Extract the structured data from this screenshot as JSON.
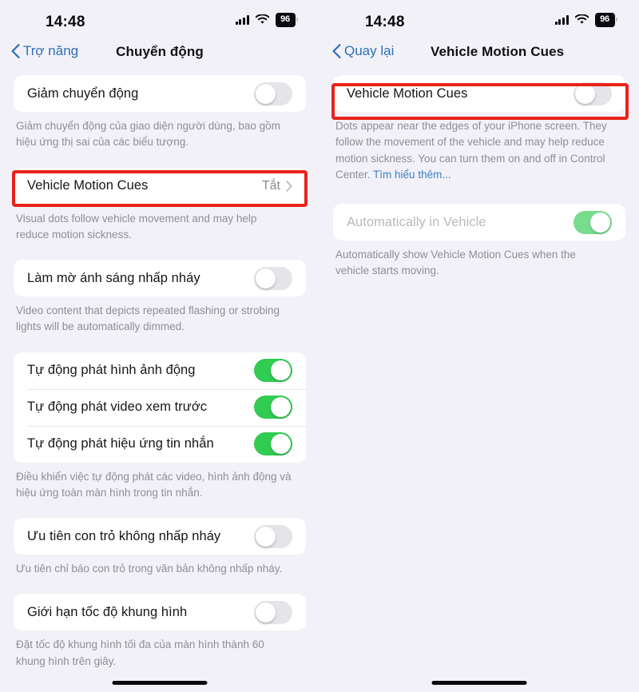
{
  "status_bar": {
    "time": "14:48",
    "battery_level": "96",
    "cellular_icon": "cellular-bars-icon",
    "wifi_icon": "wifi-icon",
    "battery_icon": "battery-icon"
  },
  "left_screen": {
    "nav": {
      "back_label": "Trợ năng",
      "back_icon": "chevron-left-icon",
      "title": "Chuyển động"
    },
    "groups": [
      {
        "rows": [
          {
            "label": "Giảm chuyển động",
            "control": "toggle",
            "state": "off"
          }
        ],
        "footnote": "Giảm chuyển động của giao diện người dùng, bao gồm hiệu ứng thị sai của các biểu tượng."
      },
      {
        "highlighted": true,
        "rows": [
          {
            "label": "Vehicle Motion Cues",
            "control": "disclosure",
            "value": "Tắt",
            "chevron_icon": "chevron-right-icon"
          }
        ],
        "footnote": "Visual dots follow vehicle movement and may help reduce motion sickness."
      },
      {
        "rows": [
          {
            "label": "Làm mờ ánh sáng nhấp nháy",
            "control": "toggle",
            "state": "off"
          }
        ],
        "footnote": "Video content that depicts repeated flashing or strobing lights will be automatically dimmed."
      },
      {
        "rows": [
          {
            "label": "Tự động phát hình ảnh động",
            "control": "toggle",
            "state": "on"
          },
          {
            "label": "Tự động phát video xem trước",
            "control": "toggle",
            "state": "on"
          },
          {
            "label": "Tự động phát hiệu ứng tin nhắn",
            "control": "toggle",
            "state": "on"
          }
        ],
        "footnote": "Điều khiển việc tự động phát các video, hình ảnh động và hiệu ứng toàn màn hình trong tin nhắn."
      },
      {
        "rows": [
          {
            "label": "Ưu tiên con trỏ không nhấp nháy",
            "control": "toggle",
            "state": "off"
          }
        ],
        "footnote": "Ưu tiên chỉ báo con trỏ trong văn bản không nhấp nháy."
      },
      {
        "rows": [
          {
            "label": "Giới hạn tốc độ khung hình",
            "control": "toggle",
            "state": "off"
          }
        ],
        "footnote": "Đặt tốc độ khung hình tối đa của màn hình thành 60 khung hình trên giây."
      }
    ]
  },
  "right_screen": {
    "nav": {
      "back_label": "Quay lại",
      "back_icon": "chevron-left-icon",
      "title": "Vehicle Motion Cues"
    },
    "groups": [
      {
        "highlighted": true,
        "rows": [
          {
            "label": "Vehicle Motion Cues",
            "control": "toggle",
            "state": "off"
          }
        ],
        "footnote": "Dots appear near the edges of your iPhone screen. They follow the movement of the vehicle and may help reduce motion sickness. You can turn them on and off in Control Center. ",
        "footnote_link": "Tìm hiểu thêm..."
      },
      {
        "dimmed": true,
        "rows": [
          {
            "label": "Automatically in Vehicle",
            "control": "toggle",
            "state": "on"
          }
        ],
        "footnote": "Automatically show Vehicle Motion Cues when the vehicle starts moving."
      }
    ]
  },
  "colors": {
    "accent_blue": "#2f6fb5",
    "link_blue": "#3d7fc1",
    "toggle_on_green": "#31cc52",
    "toggle_off_gray": "#e4e4e9",
    "highlight_red": "#e8231a",
    "page_background": "#f2f1f7",
    "card_background": "#ffffff"
  }
}
